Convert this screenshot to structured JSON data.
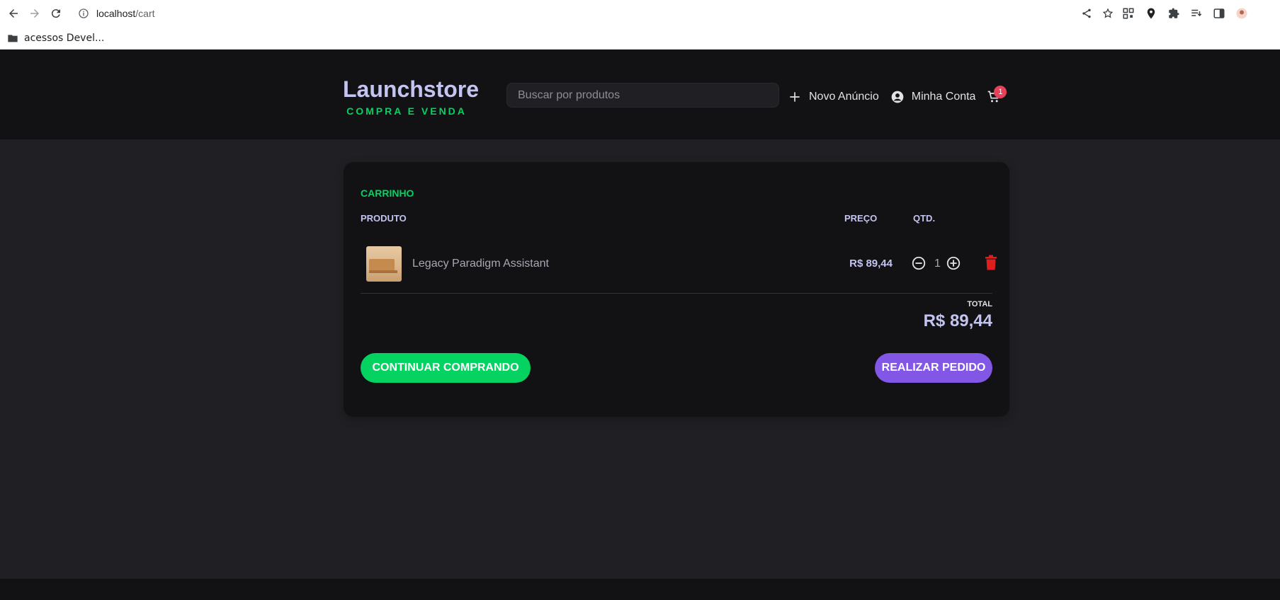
{
  "browser": {
    "url_host": "localhost",
    "url_path": "/cart",
    "bookmark_folder": "acessos Devel..."
  },
  "header": {
    "logo_title": "Launchstore",
    "logo_subtitle": "COMPRA E VENDA",
    "search_placeholder": "Buscar por produtos",
    "new_ad_label": "Novo Anúncio",
    "account_label": "Minha Conta",
    "cart_count": "1"
  },
  "cart": {
    "title": "CARRINHO",
    "columns": {
      "product": "PRODUTO",
      "price": "PREÇO",
      "qty": "QTD."
    },
    "items": [
      {
        "name": "Legacy Paradigm Assistant",
        "price": "R$ 89,44",
        "quantity": "1"
      }
    ],
    "total_label": "TOTAL",
    "total_value": "R$ 89,44",
    "continue_label": "CONTINUAR COMPRANDO",
    "order_label": "REALIZAR PEDIDO"
  },
  "colors": {
    "accent_green": "#04d361",
    "accent_purple": "#8257e5",
    "danger": "#e83f5b",
    "background": "#202024",
    "card": "#121214"
  },
  "icons": [
    "back-icon",
    "forward-icon",
    "reload-icon",
    "info-icon",
    "share-icon",
    "star-icon",
    "extension-icons",
    "folder-icon",
    "plus-icon",
    "user-circle-icon",
    "cart-icon",
    "minus-circle-icon",
    "plus-circle-icon",
    "trash-icon"
  ]
}
